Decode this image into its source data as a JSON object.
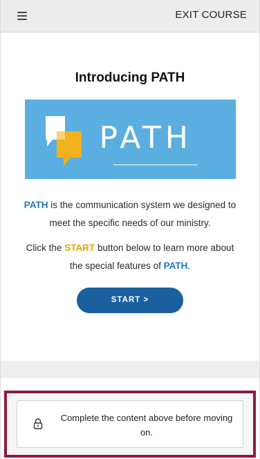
{
  "header": {
    "exit_label": "EXIT COURSE"
  },
  "main": {
    "title": "Introducing PATH",
    "banner_word": "PATH",
    "para1": {
      "keyword": "PATH",
      "text": " is the communication system we designed to meet the specific needs of our ministry."
    },
    "para2": {
      "prefix": "Click the ",
      "keyword_start": "START",
      "middle": " button below to learn more about the special features of ",
      "keyword_path": "PATH",
      "suffix": "."
    },
    "start_label": "START >"
  },
  "footer": {
    "lock_message": "Complete the content above before moving on."
  },
  "colors": {
    "banner_blue": "#5aaee0",
    "button_blue": "#1a5f9e",
    "highlight_blue": "#1e77b7",
    "highlight_yellow": "#e0a800",
    "footer_border": "#8c1c3c",
    "logo_yellow": "#f2b21b"
  },
  "icons": {
    "menu": "hamburger-menu-icon",
    "lock": "lock-icon"
  }
}
